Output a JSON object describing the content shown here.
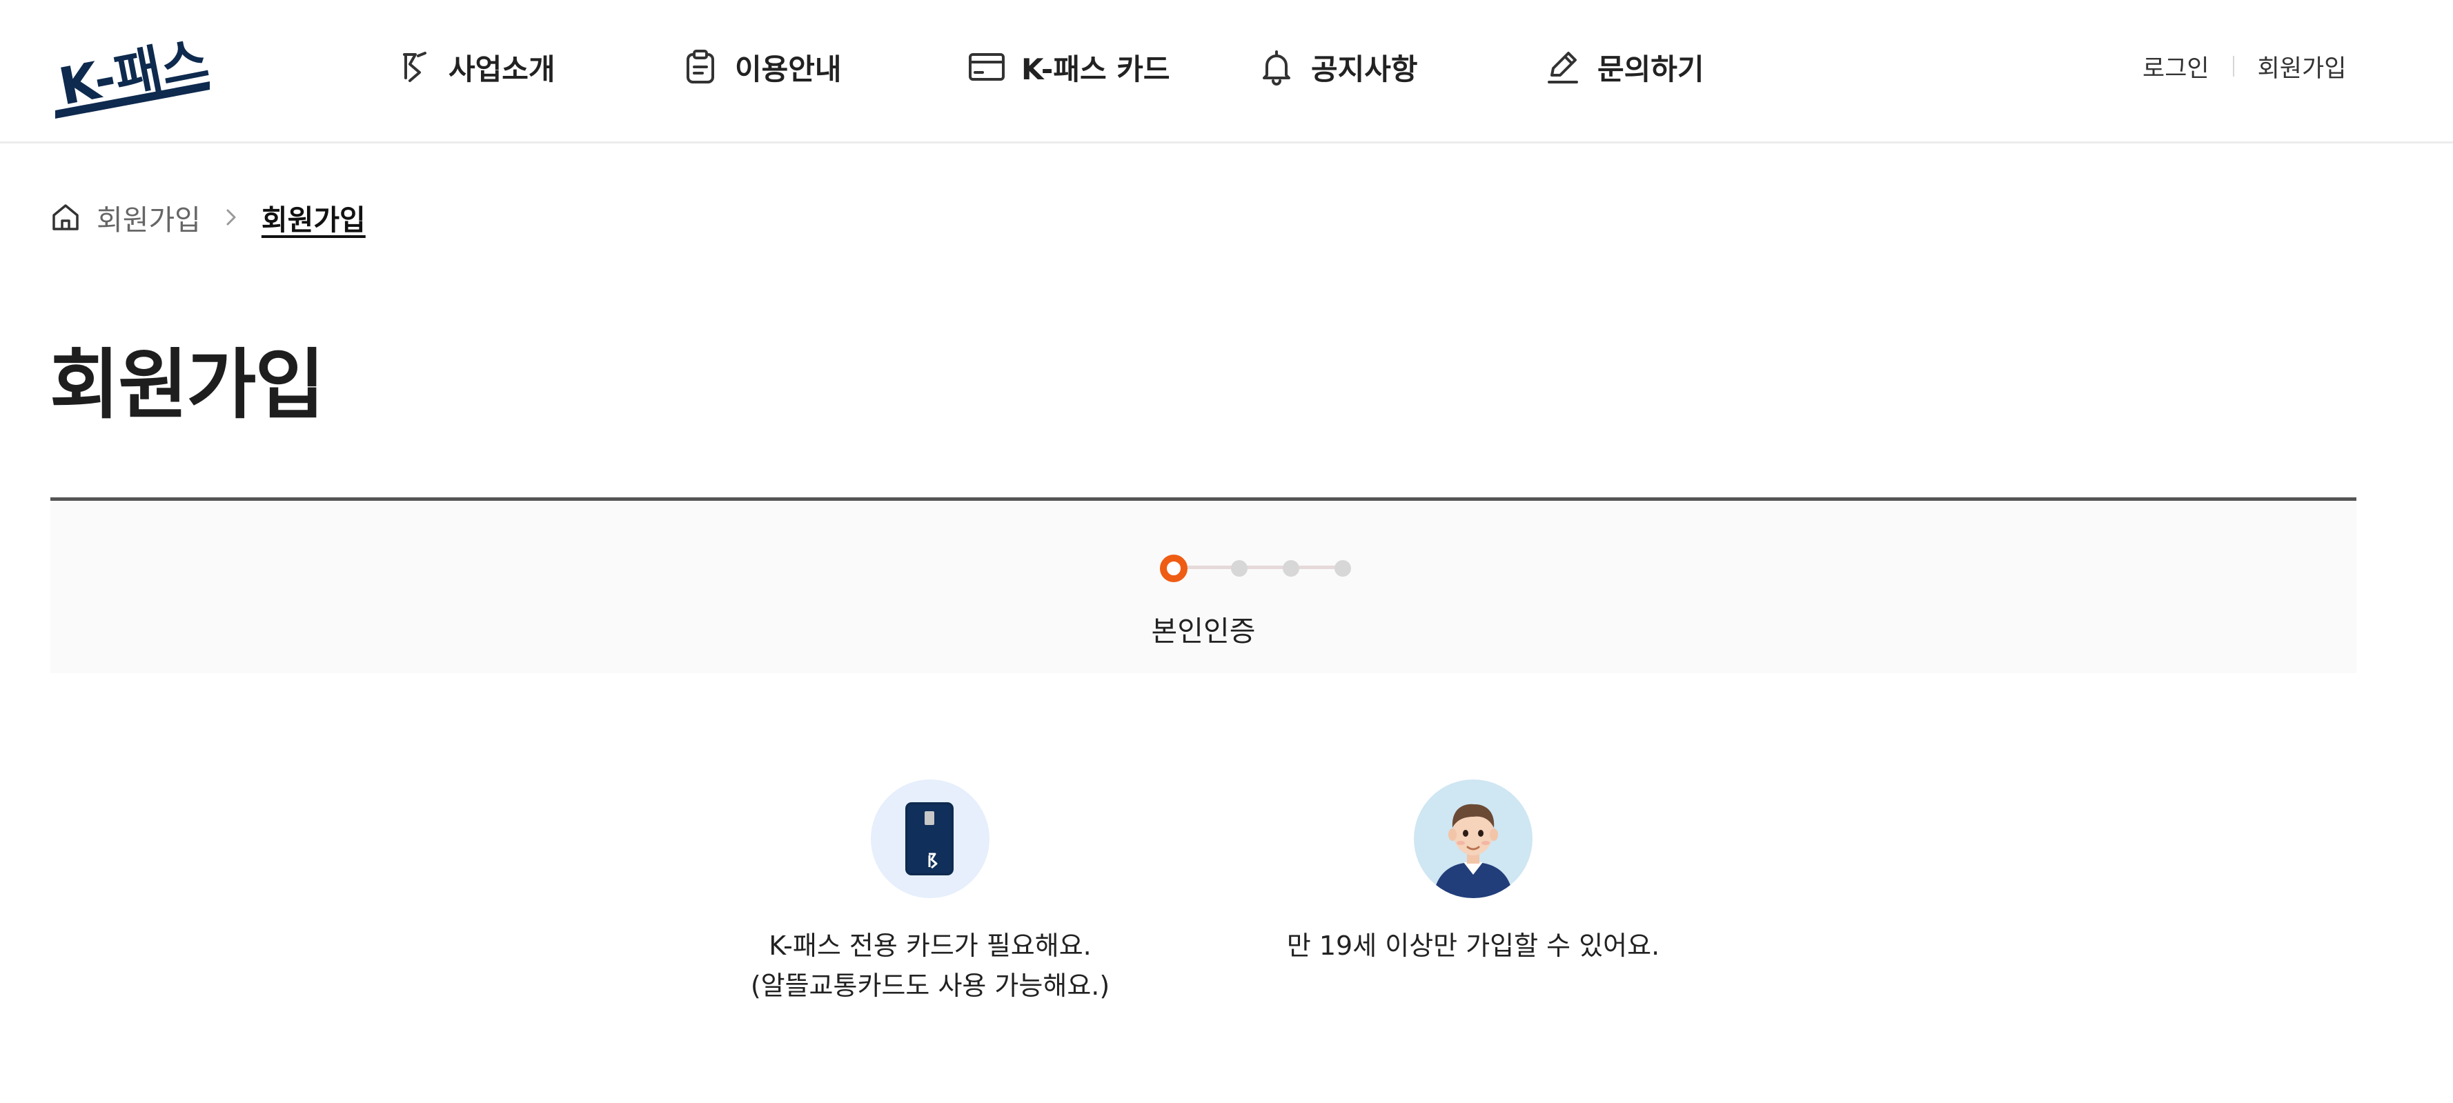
{
  "header": {
    "logo_text": "K-패스",
    "nav": [
      {
        "label": "사업소개",
        "icon": "kpass-symbol-icon"
      },
      {
        "label": "이용안내",
        "icon": "clipboard-icon"
      },
      {
        "label": "K-패스 카드",
        "icon": "card-icon"
      },
      {
        "label": "공지사항",
        "icon": "bell-icon"
      },
      {
        "label": "문의하기",
        "icon": "pencil-icon"
      }
    ],
    "login_label": "로그인",
    "signup_label": "회원가입"
  },
  "breadcrumb": {
    "home_icon": "home-icon",
    "parent": "회원가입",
    "current": "회원가입"
  },
  "page": {
    "title": "회원가입"
  },
  "stepper": {
    "current_step": 1,
    "total_steps": 4,
    "current_label": "본인인증",
    "active_color": "#ef5c14"
  },
  "requirements": [
    {
      "icon": "kpass-card-icon",
      "line1": "K-패스 전용 카드가 필요해요.",
      "line2": "(알뜰교통카드도 사용 가능해요.)"
    },
    {
      "icon": "person-avatar-icon",
      "line1": "만 19세 이상만 가입할 수 있어요.",
      "line2": ""
    }
  ],
  "colors": {
    "brand_navy": "#0e2a4e",
    "accent_orange": "#ef5c14"
  }
}
